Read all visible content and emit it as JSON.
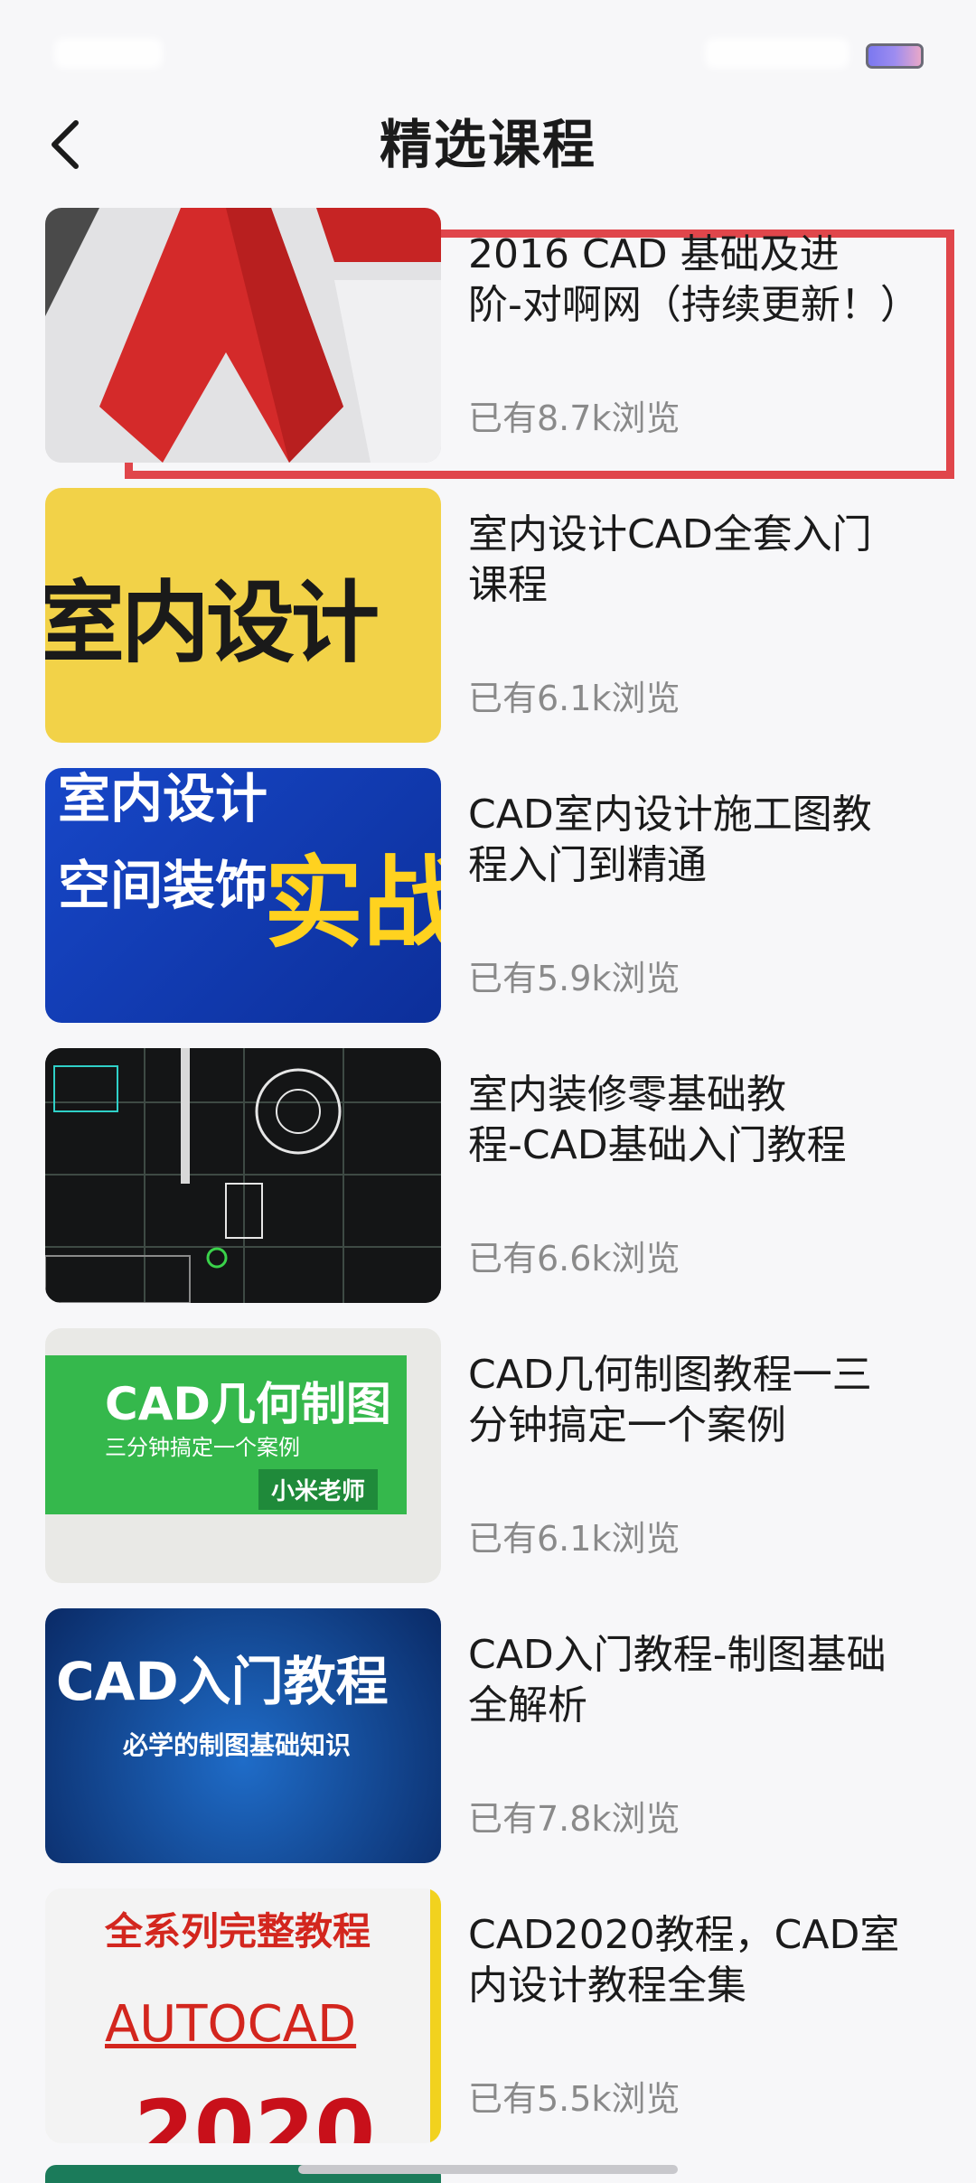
{
  "header": {
    "title": "精选课程"
  },
  "courses": [
    {
      "title": "2016 CAD 基础及进\n阶-对啊网（持续更新！）",
      "views": "已有8.7k浏览",
      "thumb_text": ""
    },
    {
      "title": "室内设计CAD全套入门\n课程",
      "views": "已有6.1k浏览",
      "thumb_text": "室内设计"
    },
    {
      "title": "CAD室内设计施工图教\n程入门到精通",
      "views": "已有5.9k浏览",
      "thumb_text": "室内设计\n空间装饰",
      "thumb_text2": "实战"
    },
    {
      "title": "室内装修零基础教\n程-CAD基础入门教程",
      "views": "已有6.6k浏览",
      "thumb_text": ""
    },
    {
      "title": "CAD几何制图教程一三\n分钟搞定一个案例",
      "views": "已有6.1k浏览",
      "thumb_text": "CAD几何制图",
      "thumb_text2": "三分钟搞定一个案例",
      "thumb_text3": "小米老师"
    },
    {
      "title": "CAD入门教程-制图基础\n全解析",
      "views": "已有7.8k浏览",
      "thumb_text": "CAD入门教程",
      "thumb_text2": "必学的制图基础知识"
    },
    {
      "title": "CAD2020教程，CAD室\n内设计教程全集",
      "views": "已有5.5k浏览",
      "thumb_text": "全系列完整教程",
      "thumb_text2": "AUTOCAD",
      "thumb_text3": "2020"
    }
  ],
  "colors": {
    "accent_red": "#e0464b",
    "background": "#f7f7f9"
  }
}
